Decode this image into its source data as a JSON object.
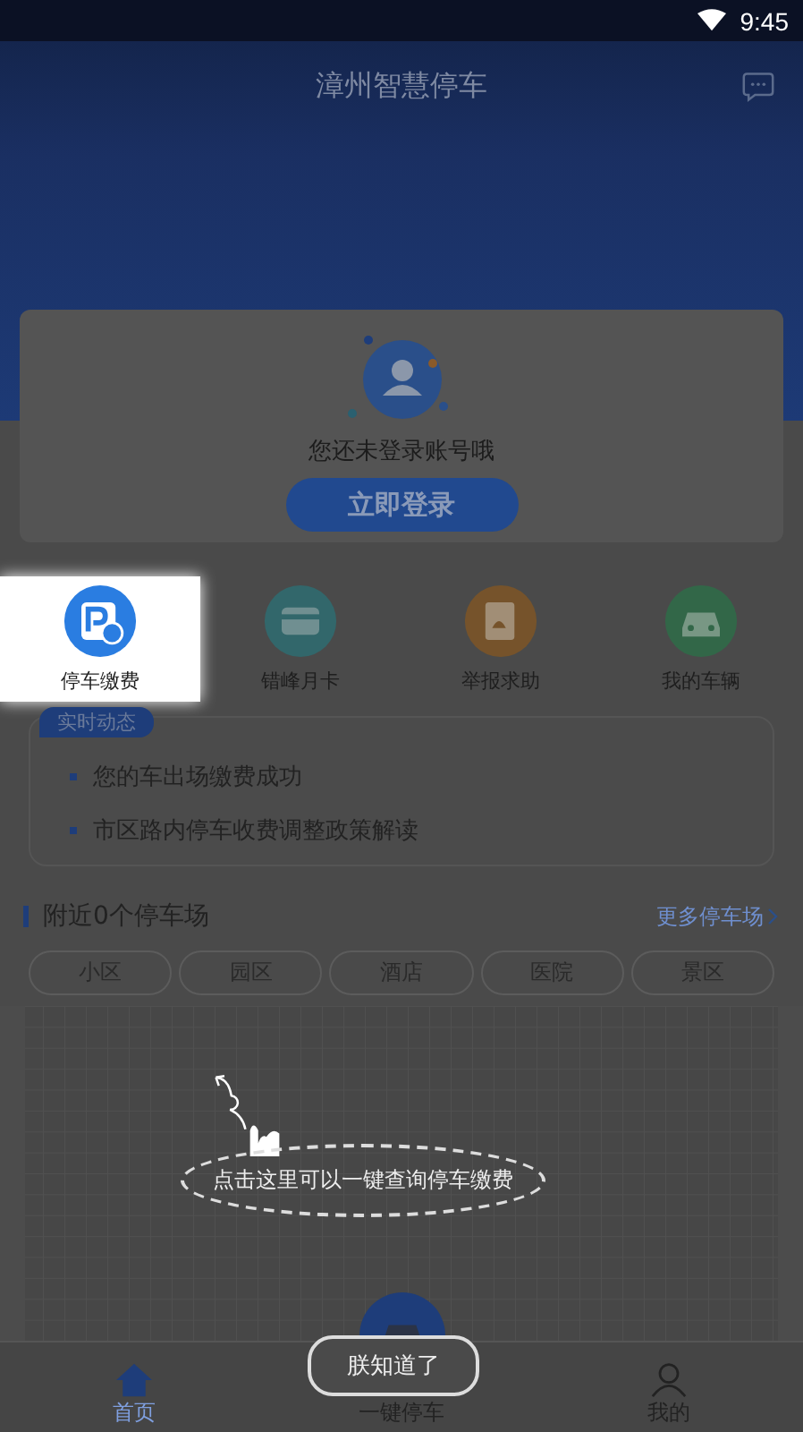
{
  "status_bar": {
    "time": "9:45"
  },
  "header": {
    "title": "漳州智慧停车"
  },
  "login_card": {
    "message": "您还未登录账号哦",
    "button": "立即登录"
  },
  "quick_actions": [
    {
      "label": "停车缴费",
      "kind": "pay",
      "highlighted": true
    },
    {
      "label": "错峰月卡",
      "kind": "card",
      "highlighted": false
    },
    {
      "label": "举报求助",
      "kind": "report",
      "highlighted": false
    },
    {
      "label": "我的车辆",
      "kind": "car",
      "highlighted": false
    }
  ],
  "news": {
    "badge": "实时动态",
    "items": [
      "您的车出场缴费成功",
      "市区路内停车收费调整政策解读"
    ]
  },
  "nearby": {
    "title": "附近0个停车场",
    "more": "更多停车场",
    "categories": [
      "小区",
      "园区",
      "酒店",
      "医院",
      "景区"
    ]
  },
  "guide": {
    "hint": "点击这里可以一键查询停车缴费",
    "dismiss": "朕知道了"
  },
  "tab_bar": [
    {
      "label": "首页",
      "kind": "home",
      "selected": true
    },
    {
      "label": "一键停车",
      "kind": "park",
      "selected": false
    },
    {
      "label": "我的",
      "kind": "profile",
      "selected": false
    }
  ]
}
